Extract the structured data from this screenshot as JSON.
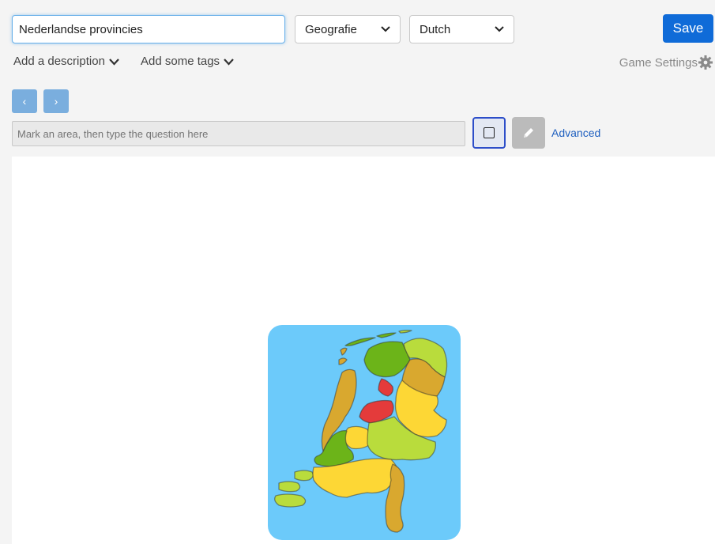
{
  "header": {
    "title_value": "Nederlandse provincies",
    "category_select": "Geografie",
    "language_select": "Dutch",
    "save_label": "Save"
  },
  "meta": {
    "description_label": "Add a description",
    "tags_label": "Add some tags",
    "game_settings_label": "Game Settings"
  },
  "nav": {
    "prev_label": "‹",
    "next_label": "›"
  },
  "question": {
    "placeholder": "Mark an area, then type the question here",
    "advanced_label": "Advanced"
  },
  "icons": {
    "prev": "chevron-left-icon",
    "next": "chevron-right-icon",
    "rect_tool": "square-icon",
    "pencil_tool": "pencil-icon",
    "settings": "gear-icon",
    "dropdown": "chevron-down-icon"
  },
  "colors": {
    "save": "#0f6bd8",
    "nav_buttons": "#7aaede",
    "rect_tool_border": "#2d4ec9",
    "pencil_tool_bg": "#bbbbbb",
    "link": "#1e5fbf",
    "map_sea": "#6ccafa",
    "map_dark_green": "#6cb419",
    "map_light_green": "#b9dc3c",
    "map_yellow": "#fdd735",
    "map_ochre": "#d9a82f",
    "map_red": "#e43b3b"
  }
}
